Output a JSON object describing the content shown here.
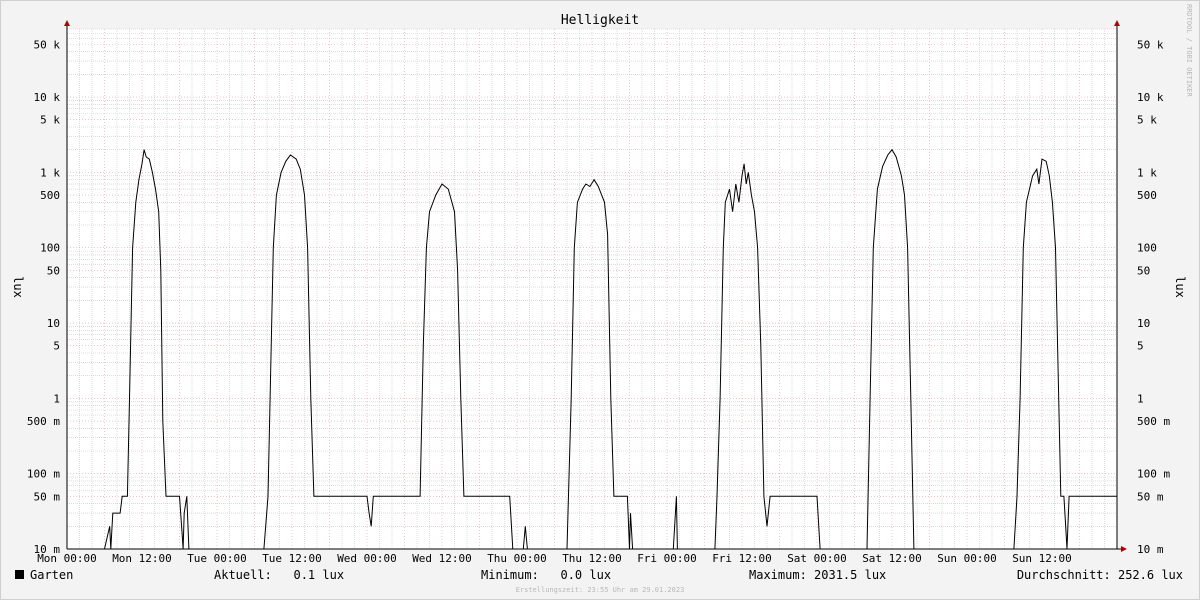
{
  "chart_data": {
    "type": "line",
    "title": "Helligkeit",
    "ylabel": "lux",
    "yscale": "log",
    "ylim": [
      0.01,
      80000
    ],
    "xlim": [
      "2023-01-23 00:00",
      "2023-01-30 00:00"
    ],
    "grid": true,
    "watermark": "RRDTOOL / TOBI OETIKER",
    "y_ticks": [
      {
        "v": 50000,
        "label": "50 k"
      },
      {
        "v": 10000,
        "label": "10 k"
      },
      {
        "v": 5000,
        "label": "5 k"
      },
      {
        "v": 1000,
        "label": "1 k"
      },
      {
        "v": 500,
        "label": "500"
      },
      {
        "v": 100,
        "label": "100"
      },
      {
        "v": 50,
        "label": "50"
      },
      {
        "v": 10,
        "label": "10"
      },
      {
        "v": 5,
        "label": "5"
      },
      {
        "v": 1,
        "label": "1"
      },
      {
        "v": 0.5,
        "label": "500 m"
      },
      {
        "v": 0.1,
        "label": "100 m"
      },
      {
        "v": 0.05,
        "label": "50 m"
      },
      {
        "v": 0.01,
        "label": "10 m"
      }
    ],
    "x_ticks": [
      {
        "x": "2023-01-23 00:00",
        "label": "Mon 00:00"
      },
      {
        "x": "2023-01-23 12:00",
        "label": "Mon 12:00"
      },
      {
        "x": "2023-01-24 00:00",
        "label": "Tue 00:00"
      },
      {
        "x": "2023-01-24 12:00",
        "label": "Tue 12:00"
      },
      {
        "x": "2023-01-25 00:00",
        "label": "Wed 00:00"
      },
      {
        "x": "2023-01-25 12:00",
        "label": "Wed 12:00"
      },
      {
        "x": "2023-01-26 00:00",
        "label": "Thu 00:00"
      },
      {
        "x": "2023-01-26 12:00",
        "label": "Thu 12:00"
      },
      {
        "x": "2023-01-27 00:00",
        "label": "Fri 00:00"
      },
      {
        "x": "2023-01-27 12:00",
        "label": "Fri 12:00"
      },
      {
        "x": "2023-01-28 00:00",
        "label": "Sat 00:00"
      },
      {
        "x": "2023-01-28 12:00",
        "label": "Sat 12:00"
      },
      {
        "x": "2023-01-29 00:00",
        "label": "Sun 00:00"
      },
      {
        "x": "2023-01-29 12:00",
        "label": "Sun 12:00"
      }
    ],
    "series": [
      {
        "name": "Garten",
        "color": "#000000",
        "points": [
          [
            "2023-01-23 00:00",
            0.01
          ],
          [
            "2023-01-23 06:00",
            0.01
          ],
          [
            "2023-01-23 06:50",
            0.02
          ],
          [
            "2023-01-23 07:00",
            0.01
          ],
          [
            "2023-01-23 07:20",
            0.03
          ],
          [
            "2023-01-23 08:30",
            0.03
          ],
          [
            "2023-01-23 08:50",
            0.05
          ],
          [
            "2023-01-23 09:40",
            0.05
          ],
          [
            "2023-01-23 10:00",
            1
          ],
          [
            "2023-01-23 10:30",
            100
          ],
          [
            "2023-01-23 11:00",
            400
          ],
          [
            "2023-01-23 11:30",
            800
          ],
          [
            "2023-01-23 12:00",
            1300
          ],
          [
            "2023-01-23 12:20",
            2000
          ],
          [
            "2023-01-23 12:40",
            1600
          ],
          [
            "2023-01-23 13:10",
            1500
          ],
          [
            "2023-01-23 13:40",
            1000
          ],
          [
            "2023-01-23 14:10",
            600
          ],
          [
            "2023-01-23 14:40",
            300
          ],
          [
            "2023-01-23 15:00",
            50
          ],
          [
            "2023-01-23 15:20",
            0.5
          ],
          [
            "2023-01-23 15:50",
            0.05
          ],
          [
            "2023-01-23 18:00",
            0.05
          ],
          [
            "2023-01-23 18:20",
            0.02
          ],
          [
            "2023-01-23 18:35",
            0.01
          ],
          [
            "2023-01-23 18:45",
            0.03
          ],
          [
            "2023-01-23 19:10",
            0.05
          ],
          [
            "2023-01-23 19:30",
            0.01
          ],
          [
            "2023-01-24 07:30",
            0.01
          ],
          [
            "2023-01-24 08:10",
            0.05
          ],
          [
            "2023-01-24 08:30",
            1
          ],
          [
            "2023-01-24 09:00",
            100
          ],
          [
            "2023-01-24 09:30",
            500
          ],
          [
            "2023-01-24 10:15",
            1000
          ],
          [
            "2023-01-24 11:00",
            1400
          ],
          [
            "2023-01-24 11:45",
            1700
          ],
          [
            "2023-01-24 12:40",
            1500
          ],
          [
            "2023-01-24 13:20",
            1100
          ],
          [
            "2023-01-24 14:00",
            500
          ],
          [
            "2023-01-24 14:30",
            100
          ],
          [
            "2023-01-24 15:00",
            1
          ],
          [
            "2023-01-24 15:30",
            0.05
          ],
          [
            "2023-01-25 00:00",
            0.05
          ],
          [
            "2023-01-25 00:20",
            0.03
          ],
          [
            "2023-01-25 00:40",
            0.02
          ],
          [
            "2023-01-25 01:00",
            0.05
          ],
          [
            "2023-01-25 08:30",
            0.05
          ],
          [
            "2023-01-25 09:00",
            5
          ],
          [
            "2023-01-25 09:30",
            100
          ],
          [
            "2023-01-25 10:00",
            300
          ],
          [
            "2023-01-25 11:00",
            500
          ],
          [
            "2023-01-25 12:00",
            700
          ],
          [
            "2023-01-25 13:00",
            600
          ],
          [
            "2023-01-25 14:00",
            300
          ],
          [
            "2023-01-25 14:30",
            50
          ],
          [
            "2023-01-25 15:00",
            1
          ],
          [
            "2023-01-25 15:30",
            0.05
          ],
          [
            "2023-01-25 22:50",
            0.05
          ],
          [
            "2023-01-25 23:20",
            0.01
          ],
          [
            "2023-01-26 01:00",
            0.01
          ],
          [
            "2023-01-26 01:20",
            0.02
          ],
          [
            "2023-01-26 01:40",
            0.01
          ],
          [
            "2023-01-26 08:00",
            0.01
          ],
          [
            "2023-01-26 08:40",
            1
          ],
          [
            "2023-01-26 09:10",
            100
          ],
          [
            "2023-01-26 09:40",
            400
          ],
          [
            "2023-01-26 10:30",
            600
          ],
          [
            "2023-01-26 11:00",
            700
          ],
          [
            "2023-01-26 11:40",
            650
          ],
          [
            "2023-01-26 12:20",
            800
          ],
          [
            "2023-01-26 13:00",
            650
          ],
          [
            "2023-01-26 14:00",
            400
          ],
          [
            "2023-01-26 14:30",
            150
          ],
          [
            "2023-01-26 15:00",
            1
          ],
          [
            "2023-01-26 15:30",
            0.05
          ],
          [
            "2023-01-26 17:40",
            0.05
          ],
          [
            "2023-01-26 18:00",
            0.01
          ],
          [
            "2023-01-26 18:10",
            0.03
          ],
          [
            "2023-01-26 18:30",
            0.01
          ],
          [
            "2023-01-27 01:00",
            0.01
          ],
          [
            "2023-01-27 01:30",
            0.05
          ],
          [
            "2023-01-27 01:40",
            0.01
          ],
          [
            "2023-01-27 07:40",
            0.01
          ],
          [
            "2023-01-27 08:00",
            0.05
          ],
          [
            "2023-01-27 08:30",
            1
          ],
          [
            "2023-01-27 09:00",
            100
          ],
          [
            "2023-01-27 09:20",
            400
          ],
          [
            "2023-01-27 10:00",
            600
          ],
          [
            "2023-01-27 10:30",
            300
          ],
          [
            "2023-01-27 11:00",
            700
          ],
          [
            "2023-01-27 11:30",
            400
          ],
          [
            "2023-01-27 12:00",
            900
          ],
          [
            "2023-01-27 12:20",
            1300
          ],
          [
            "2023-01-27 12:40",
            700
          ],
          [
            "2023-01-27 13:00",
            1000
          ],
          [
            "2023-01-27 13:30",
            500
          ],
          [
            "2023-01-27 14:00",
            300
          ],
          [
            "2023-01-27 14:30",
            100
          ],
          [
            "2023-01-27 15:00",
            5
          ],
          [
            "2023-01-27 15:30",
            0.05
          ],
          [
            "2023-01-27 16:00",
            0.02
          ],
          [
            "2023-01-27 16:30",
            0.05
          ],
          [
            "2023-01-28 00:00",
            0.05
          ],
          [
            "2023-01-28 00:30",
            0.01
          ],
          [
            "2023-01-28 08:00",
            0.01
          ],
          [
            "2023-01-28 08:30",
            1
          ],
          [
            "2023-01-28 09:00",
            100
          ],
          [
            "2023-01-28 09:40",
            600
          ],
          [
            "2023-01-28 10:30",
            1200
          ],
          [
            "2023-01-28 11:20",
            1700
          ],
          [
            "2023-01-28 12:00",
            2000
          ],
          [
            "2023-01-28 12:40",
            1600
          ],
          [
            "2023-01-28 13:30",
            900
          ],
          [
            "2023-01-28 14:00",
            500
          ],
          [
            "2023-01-28 14:30",
            100
          ],
          [
            "2023-01-28 15:00",
            1
          ],
          [
            "2023-01-28 15:30",
            0.01
          ],
          [
            "2023-01-29 07:30",
            0.01
          ],
          [
            "2023-01-29 08:00",
            0.05
          ],
          [
            "2023-01-29 08:30",
            1
          ],
          [
            "2023-01-29 09:00",
            100
          ],
          [
            "2023-01-29 09:30",
            400
          ],
          [
            "2023-01-29 10:30",
            900
          ],
          [
            "2023-01-29 11:10",
            1100
          ],
          [
            "2023-01-29 11:30",
            700
          ],
          [
            "2023-01-29 12:00",
            1500
          ],
          [
            "2023-01-29 12:40",
            1400
          ],
          [
            "2023-01-29 13:10",
            900
          ],
          [
            "2023-01-29 13:40",
            400
          ],
          [
            "2023-01-29 14:10",
            100
          ],
          [
            "2023-01-29 14:40",
            1
          ],
          [
            "2023-01-29 15:00",
            0.05
          ],
          [
            "2023-01-29 15:30",
            0.05
          ],
          [
            "2023-01-29 16:00",
            0.01
          ],
          [
            "2023-01-29 16:20",
            0.05
          ],
          [
            "2023-01-29 23:55",
            0.05
          ]
        ]
      }
    ]
  },
  "legend": {
    "swatch_color": "#000000",
    "series_name": "Garten",
    "current": "Aktuell:   0.1 lux",
    "minimum": "Minimum:   0.0 lux",
    "maximum": "Maximum: 2031.5 lux",
    "average": "Durchschnitt: 252.6 lux"
  },
  "footer": "Erstellungszeit: 23:55 Uhr am 29.01.2023",
  "colors": {
    "background": "#f3f3f3",
    "plot_area": "#ffffff",
    "major_grid": "#e8a0a8",
    "minor_grid": "#c8c8c8",
    "arrow": "#b00000"
  }
}
